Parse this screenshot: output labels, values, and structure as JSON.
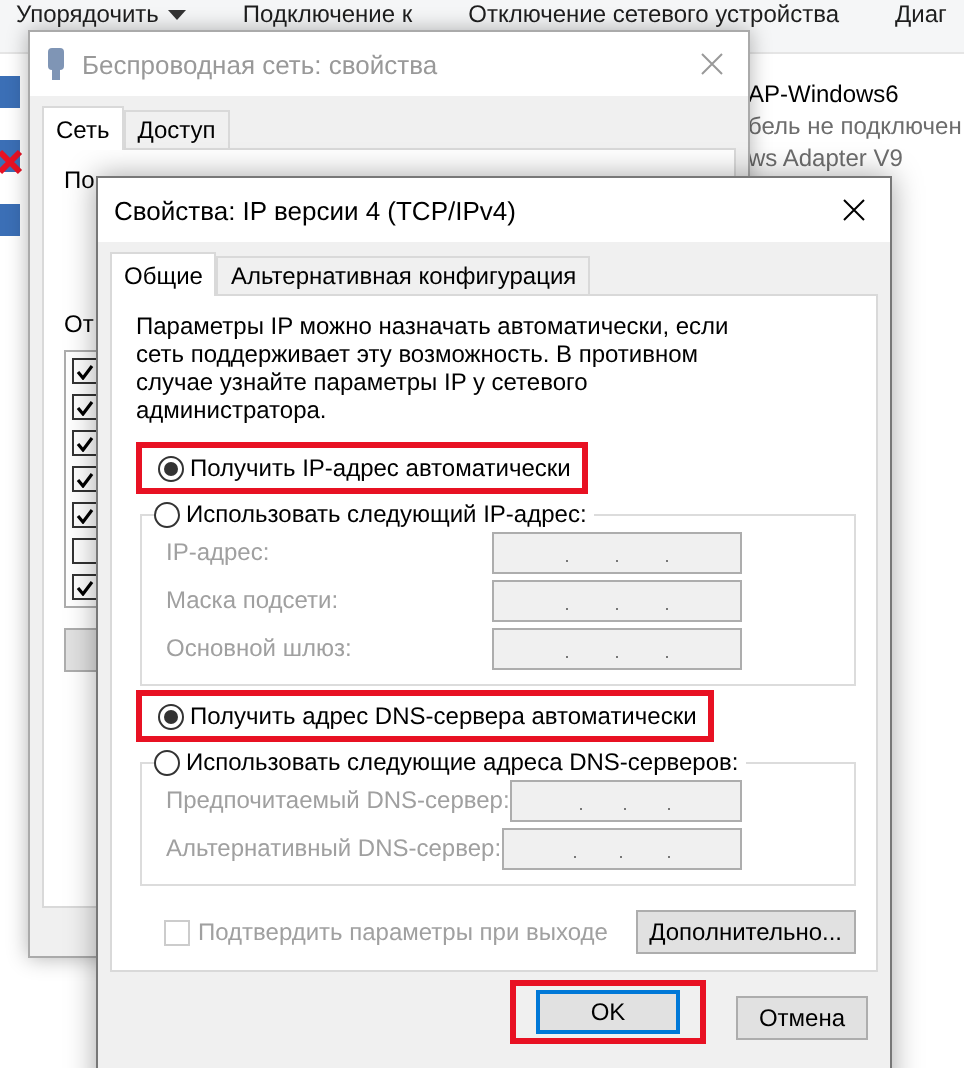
{
  "explorer": {
    "toolbar": [
      {
        "label": "Упорядочить",
        "dropdown": true
      },
      {
        "label": "Подключение к"
      },
      {
        "label": "Отключение сетевого устройства"
      },
      {
        "label": "Диаг"
      }
    ],
    "adapter_lines": [
      "AP-Windows6",
      "бель не подключен",
      "ws Adapter V9"
    ]
  },
  "back_window": {
    "title": "Беспроводная сеть: свойства",
    "tabs": [
      {
        "label": "Сеть",
        "selected": true
      },
      {
        "label": "Доступ",
        "selected": false
      }
    ],
    "labels": [
      "По",
      "От"
    ],
    "components": [
      {
        "checked": true
      },
      {
        "checked": true
      },
      {
        "checked": true
      },
      {
        "checked": true
      },
      {
        "checked": true
      },
      {
        "checked": false
      },
      {
        "checked": true
      }
    ]
  },
  "dialog": {
    "title": "Свойства: IP версии 4 (TCP/IPv4)",
    "tabs": [
      {
        "label": "Общие",
        "selected": true
      },
      {
        "label": "Альтернативная конфигурация",
        "selected": false
      }
    ],
    "intro": "Параметры IP можно назначать автоматически, если сеть поддерживает эту возможность. В противном случае узнайте параметры IP у сетевого администратора.",
    "ip_group": {
      "auto": {
        "label": "Получить IP-адрес автоматически",
        "selected": true,
        "highlighted": true
      },
      "manual": {
        "label": "Использовать следующий IP-адрес:",
        "selected": false
      },
      "fields": [
        {
          "label": "IP-адрес:"
        },
        {
          "label": "Маска подсети:"
        },
        {
          "label": "Основной шлюз:"
        }
      ]
    },
    "dns_group": {
      "auto": {
        "label": "Получить адрес DNS-сервера автоматически",
        "selected": true,
        "highlighted": true
      },
      "manual": {
        "label": "Использовать следующие адреса DNS-серверов:",
        "selected": false
      },
      "fields": [
        {
          "label": "Предпочитаемый DNS-сервер:"
        },
        {
          "label": "Альтернативный DNS-сервер:"
        }
      ]
    },
    "validate": {
      "label": "Подтвердить параметры при выходе",
      "checked": false,
      "disabled": true
    },
    "advanced_button": "Дополнительно...",
    "buttons": [
      {
        "label": "OK",
        "default": true,
        "highlighted": true
      },
      {
        "label": "Отмена",
        "default": false
      }
    ]
  }
}
